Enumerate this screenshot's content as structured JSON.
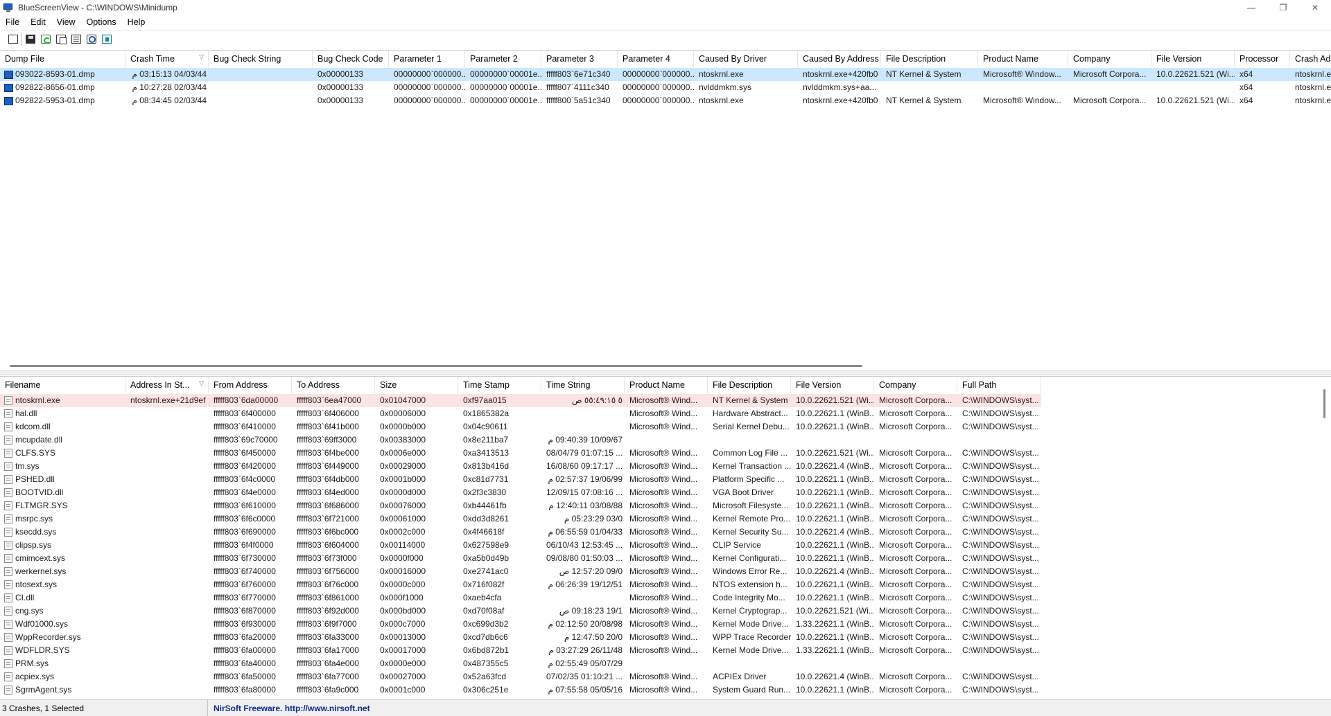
{
  "window": {
    "title": "BlueScreenView  -  C:\\WINDOWS\\Minidump",
    "minimize": "—",
    "maximize": "❐",
    "close": "✕"
  },
  "menu": [
    "File",
    "Edit",
    "View",
    "Options",
    "Help"
  ],
  "toolbar": [
    "properties-icon",
    "save-icon",
    "refresh-icon",
    "copy-icon",
    "html-report-icon",
    "find-icon",
    "exit-icon"
  ],
  "crashes": {
    "columns": [
      "Dump File",
      "Crash Time",
      "Bug Check String",
      "Bug Check Code",
      "Parameter 1",
      "Parameter 2",
      "Parameter 3",
      "Parameter 4",
      "Caused By Driver",
      "Caused By Address",
      "File Description",
      "Product Name",
      "Company",
      "File Version",
      "Processor",
      "Crash Add"
    ],
    "sorted_column": "Crash Time",
    "rows": [
      [
        "093022-8593-01.dmp",
        "04/03/44 03:15:13 م",
        "",
        "0x00000133",
        "00000000`000000...",
        "00000000`00001e...",
        "fffff803`6e71c340",
        "00000000`000000...",
        "ntoskrnl.exe",
        "ntoskrnl.exe+420fb0",
        "NT Kernel & System",
        "Microsoft® Window...",
        "Microsoft Corpora...",
        "10.0.22621.521 (Wi...",
        "x64",
        "ntoskrnl.e"
      ],
      [
        "092822-8656-01.dmp",
        "02/03/44 10:27:28 م",
        "",
        "0x00000133",
        "00000000`000000...",
        "00000000`00001e...",
        "fffff807`4111c340",
        "00000000`000000...",
        "nvlddmkm.sys",
        "nvlddmkm.sys+aa...",
        "",
        "",
        "",
        "",
        "x64",
        "ntoskrnl.e"
      ],
      [
        "092822-5953-01.dmp",
        "02/03/44 08:34:45 م",
        "",
        "0x00000133",
        "00000000`000000...",
        "00000000`00001e...",
        "fffff800`5a51c340",
        "00000000`000000...",
        "ntoskrnl.exe",
        "ntoskrnl.exe+420fb0",
        "NT Kernel & System",
        "Microsoft® Window...",
        "Microsoft Corpora...",
        "10.0.22621.521 (Wi...",
        "x64",
        "ntoskrnl.e"
      ]
    ]
  },
  "drivers": {
    "columns": [
      "Filename",
      "Address In St...",
      "From Address",
      "To Address",
      "Size",
      "Time Stamp",
      "Time String",
      "Product Name",
      "File Description",
      "File Version",
      "Company",
      "Full Path"
    ],
    "sorted_column": "Address In St...",
    "rows": [
      [
        "ntoskrnl.exe",
        "ntoskrnl.exe+21d9ef",
        "fffff803`6da00000",
        "fffff803`6ea47000",
        "0x01047000",
        "0xf97aa015",
        "٥ ٥٥:٤٩:١٥ ص",
        "Microsoft® Wind...",
        "NT Kernel & System",
        "10.0.22621.521 (Wi...",
        "Microsoft Corpora...",
        "C:\\WINDOWS\\syst..."
      ],
      [
        "hal.dll",
        "",
        "fffff803`6f400000",
        "fffff803`6f406000",
        "0x00006000",
        "0x1865382a",
        "",
        "Microsoft® Wind...",
        "Hardware Abstract...",
        "10.0.22621.1 (WinB...",
        "Microsoft Corpora...",
        "C:\\WINDOWS\\syst..."
      ],
      [
        "kdcom.dll",
        "",
        "fffff803`6f410000",
        "fffff803`6f41b000",
        "0x0000b000",
        "0x04c90611",
        "",
        "Microsoft® Wind...",
        "Serial Kernel Debu...",
        "10.0.22621.1 (WinB...",
        "Microsoft Corpora...",
        "C:\\WINDOWS\\syst..."
      ],
      [
        "mcupdate.dll",
        "",
        "fffff803`69c70000",
        "fffff803`69ff3000",
        "0x00383000",
        "0x8e211ba7",
        "10/09/67 09:40:39 م",
        "",
        "",
        "",
        "",
        ""
      ],
      [
        "CLFS.SYS",
        "",
        "fffff803`6f450000",
        "fffff803`6f4be000",
        "0x0006e000",
        "0xa3413513",
        "08/04/79 01:07:15 ...",
        "Microsoft® Wind...",
        "Common Log File ...",
        "10.0.22621.521 (Wi...",
        "Microsoft Corpora...",
        "C:\\WINDOWS\\syst..."
      ],
      [
        "tm.sys",
        "",
        "fffff803`6f420000",
        "fffff803`6f449000",
        "0x00029000",
        "0x813b416d",
        "16/08/60 09:17:17 ...",
        "Microsoft® Wind...",
        "Kernel Transaction ...",
        "10.0.22621.4 (WinB...",
        "Microsoft Corpora...",
        "C:\\WINDOWS\\syst..."
      ],
      [
        "PSHED.dll",
        "",
        "fffff803`6f4c0000",
        "fffff803`6f4db000",
        "0x0001b000",
        "0xc81d7731",
        "19/06/99 02:57:37 م",
        "Microsoft® Wind...",
        "Platform Specific ...",
        "10.0.22621.1 (WinB...",
        "Microsoft Corpora...",
        "C:\\WINDOWS\\syst..."
      ],
      [
        "BOOTVID.dll",
        "",
        "fffff803`6f4e0000",
        "fffff803`6f4ed000",
        "0x0000d000",
        "0x2f3c3830",
        "12/09/15 07:08:16 ...",
        "Microsoft® Wind...",
        "VGA Boot Driver",
        "10.0.22621.1 (WinB...",
        "Microsoft Corpora...",
        "C:\\WINDOWS\\syst..."
      ],
      [
        "FLTMGR.SYS",
        "",
        "fffff803`6f610000",
        "fffff803`6f686000",
        "0x00076000",
        "0xb44461fb",
        "03/08/88 12:40:11 م",
        "Microsoft® Wind...",
        "Microsoft Filesyste...",
        "10.0.22621.1 (WinB...",
        "Microsoft Corpora...",
        "C:\\WINDOWS\\syst..."
      ],
      [
        "msrpc.sys",
        "",
        "fffff803`6f6c0000",
        "fffff803`6f721000",
        "0x00061000",
        "0xdd3d8261",
        "03/0 05:23:29 م",
        "Microsoft® Wind...",
        "Kernel Remote Pro...",
        "10.0.22621.1 (WinB...",
        "Microsoft Corpora...",
        "C:\\WINDOWS\\syst..."
      ],
      [
        "ksecdd.sys",
        "",
        "fffff803`6f690000",
        "fffff803`6f6bc000",
        "0x0002c000",
        "0x4f46618f",
        "01/04/33 06:55:59 م",
        "Microsoft® Wind...",
        "Kernel Security Su...",
        "10.0.22621.4 (WinB...",
        "Microsoft Corpora...",
        "C:\\WINDOWS\\syst..."
      ],
      [
        "clipsp.sys",
        "",
        "fffff803`6f4f0000",
        "fffff803`6f604000",
        "0x00114000",
        "0x627598e9",
        "06/10/43 12:53:45 ...",
        "Microsoft® Wind...",
        "CLIP Service",
        "10.0.22621.1 (WinB...",
        "Microsoft Corpora...",
        "C:\\WINDOWS\\syst..."
      ],
      [
        "cmimcext.sys",
        "",
        "fffff803`6f730000",
        "fffff803`6f73f000",
        "0x0000f000",
        "0xa5b0d49b",
        "09/08/80 01:50:03 ...",
        "Microsoft® Wind...",
        "Kernel Configurati...",
        "10.0.22621.1 (WinB...",
        "Microsoft Corpora...",
        "C:\\WINDOWS\\syst..."
      ],
      [
        "werkernel.sys",
        "",
        "fffff803`6f740000",
        "fffff803`6f756000",
        "0x00016000",
        "0xe2741ac0",
        "09/0 12:57:20 ص",
        "Microsoft® Wind...",
        "Windows Error Re...",
        "10.0.22621.4 (WinB...",
        "Microsoft Corpora...",
        "C:\\WINDOWS\\syst..."
      ],
      [
        "ntosext.sys",
        "",
        "fffff803`6f760000",
        "fffff803`6f76c000",
        "0x0000c000",
        "0x716f082f",
        "19/12/51 06:26:39 م",
        "Microsoft® Wind...",
        "NTOS extension h...",
        "10.0.22621.1 (WinB...",
        "Microsoft Corpora...",
        "C:\\WINDOWS\\syst..."
      ],
      [
        "CI.dll",
        "",
        "fffff803`6f770000",
        "fffff803`6f861000",
        "0x000f1000",
        "0xaeb4cfa",
        "",
        "Microsoft® Wind...",
        "Code Integrity Mo...",
        "10.0.22621.1 (WinB...",
        "Microsoft Corpora...",
        "C:\\WINDOWS\\syst..."
      ],
      [
        "cng.sys",
        "",
        "fffff803`6f870000",
        "fffff803`6f92d000",
        "0x000bd000",
        "0xd70f08af",
        "19/1 09:18:23 ص",
        "Microsoft® Wind...",
        "Kernel Cryptograp...",
        "10.0.22621.521 (Wi...",
        "Microsoft Corpora...",
        "C:\\WINDOWS\\syst..."
      ],
      [
        "Wdf01000.sys",
        "",
        "fffff803`6f930000",
        "fffff803`6f9f7000",
        "0x000c7000",
        "0xc699d3b2",
        "20/08/98 02:12:50 م",
        "Microsoft® Wind...",
        "Kernel Mode Drive...",
        "1.33.22621.1 (WinB...",
        "Microsoft Corpora...",
        "C:\\WINDOWS\\syst..."
      ],
      [
        "WppRecorder.sys",
        "",
        "fffff803`6fa20000",
        "fffff803`6fa33000",
        "0x00013000",
        "0xcd7db6c6",
        "20/0 12:47:50 م",
        "Microsoft® Wind...",
        "WPP Trace Recorder",
        "10.0.22621.1 (WinB...",
        "Microsoft Corpora...",
        "C:\\WINDOWS\\syst..."
      ],
      [
        "WDFLDR.SYS",
        "",
        "fffff803`6fa00000",
        "fffff803`6fa17000",
        "0x00017000",
        "0x6bd872b1",
        "26/11/48 03:27:29 م",
        "Microsoft® Wind...",
        "Kernel Mode Drive...",
        "1.33.22621.1 (WinB...",
        "Microsoft Corpora...",
        "C:\\WINDOWS\\syst..."
      ],
      [
        "PRM.sys",
        "",
        "fffff803`6fa40000",
        "fffff803`6fa4e000",
        "0x0000e000",
        "0x487355c5",
        "05/07/29 02:55:49 م",
        "",
        "",
        "",
        "",
        ""
      ],
      [
        "acpiex.sys",
        "",
        "fffff803`6fa50000",
        "fffff803`6fa77000",
        "0x00027000",
        "0x52a63fcd",
        "07/02/35 01:10:21 ...",
        "Microsoft® Wind...",
        "ACPIEx Driver",
        "10.0.22621.4 (WinB...",
        "Microsoft Corpora...",
        "C:\\WINDOWS\\syst..."
      ],
      [
        "SgrmAgent.sys",
        "",
        "fffff803`6fa80000",
        "fffff803`6fa9c000",
        "0x0001c000",
        "0x306c251e",
        "05/05/16 07:55:58 م",
        "Microsoft® Wind...",
        "System Guard Run...",
        "10.0.22621.1 (WinB...",
        "Microsoft Corpora...",
        "C:\\WINDOWS\\syst..."
      ]
    ]
  },
  "status": {
    "summary": "3 Crashes, 1 Selected",
    "link": "NirSoft Freeware.  http://www.nirsoft.net"
  }
}
